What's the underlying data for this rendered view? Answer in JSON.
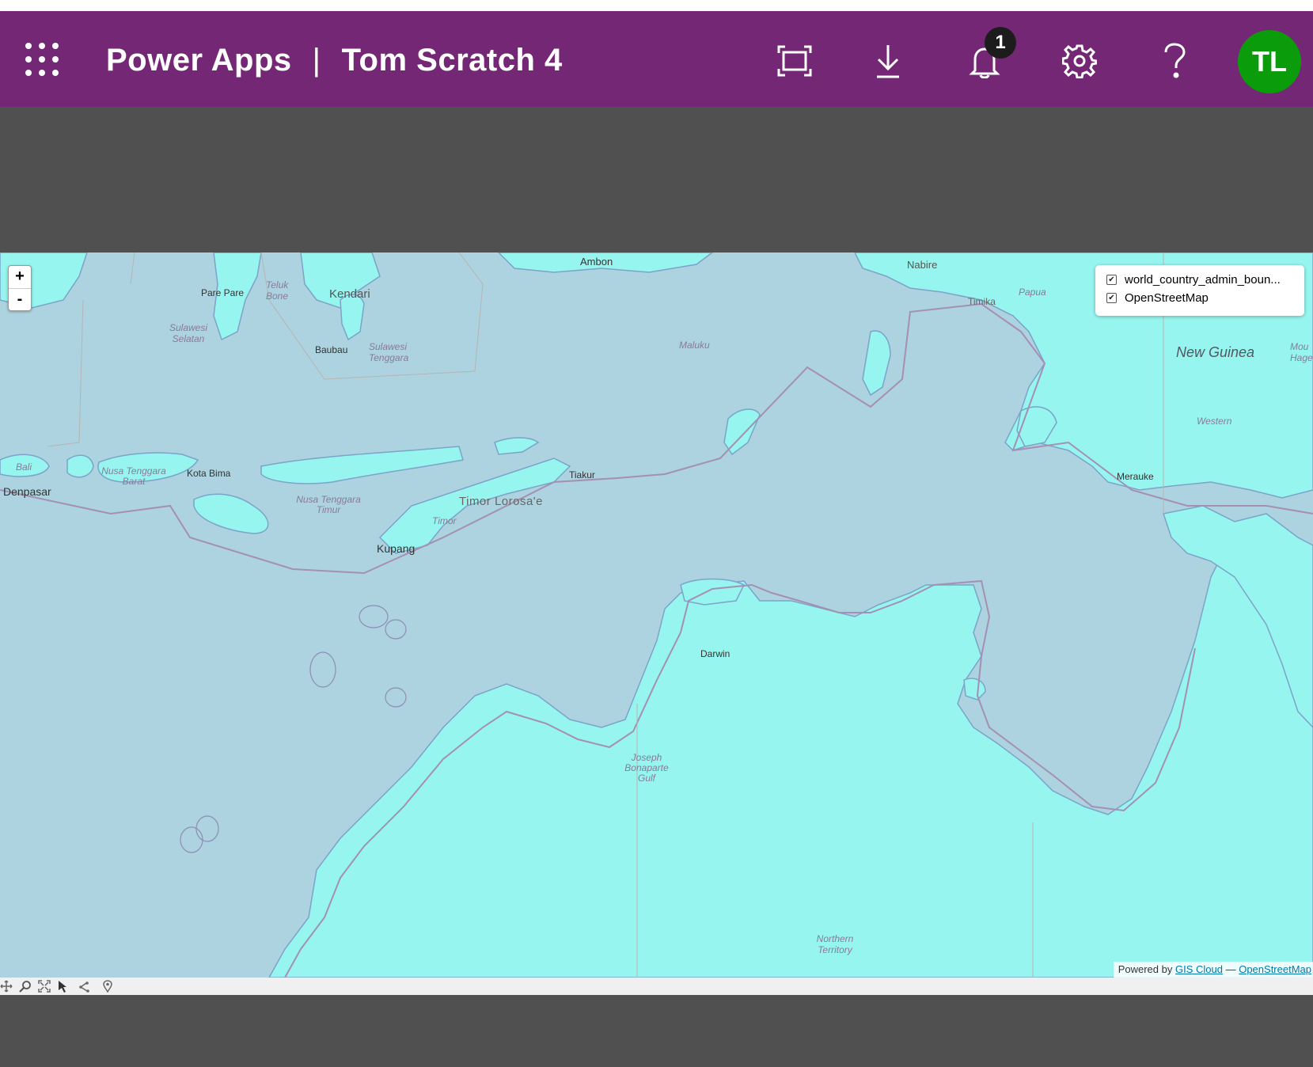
{
  "header": {
    "app_name": "Power Apps",
    "separator": "|",
    "app_title": "Tom Scratch 4",
    "notification_count": "1",
    "user_initials": "TL",
    "bg_color": "#742774",
    "avatar_color": "#0a9c0a",
    "icons": [
      "app-launcher-icon",
      "fit-to-window-icon",
      "download-icon",
      "bell-icon",
      "gear-icon",
      "help-icon"
    ]
  },
  "map": {
    "zoom_in": "+",
    "zoom_out": "-",
    "layers": [
      {
        "label": "world_country_admin_boun...",
        "checked": true
      },
      {
        "label": "OpenStreetMap",
        "checked": true
      }
    ],
    "attribution": {
      "prefix": "Powered by",
      "gis_link": "GIS Cloud",
      "dash": "—",
      "osm_link": "OpenStreetMap"
    },
    "labels": {
      "ambon": "Ambon",
      "nabire": "Nabire",
      "timika": "Timika",
      "papua": "Papua",
      "new_guinea": "New Guinea",
      "western": "Western",
      "merauke": "Merauke",
      "pare_pare": "Pare Pare",
      "teluk_bone": "Teluk Bone",
      "kendari": "Kendari",
      "sulawesi_selatan": "Sulawesi Selatan",
      "baubau": "Baubau",
      "sulawesi_tenggara": "Sulawesi Tenggara",
      "maluku": "Maluku",
      "bali": "Bali",
      "denpasar": "Denpasar",
      "ntb": "Nusa Tenggara Barat",
      "kota_bima": "Kota Bima",
      "ntt": "Nusa Tenggara Timur",
      "timor_leste": "Timor Lorosa'e",
      "timor": "Timor",
      "kupang": "Kupang",
      "tiakur": "Tiakur",
      "darwin": "Darwin",
      "joseph_bonaparte": "Joseph Bonaparte Gulf",
      "northern_territory": "Northern Territory",
      "mou_hage": "Mou Hage"
    },
    "land_color": "#96f5ef",
    "water_color": "#acd3df"
  },
  "toolbar": {
    "tools": [
      "pan-tool-icon",
      "zoom-tool-icon",
      "full-extent-icon",
      "select-tool-icon",
      "measure-tool-icon",
      "marker-tool-icon"
    ]
  }
}
